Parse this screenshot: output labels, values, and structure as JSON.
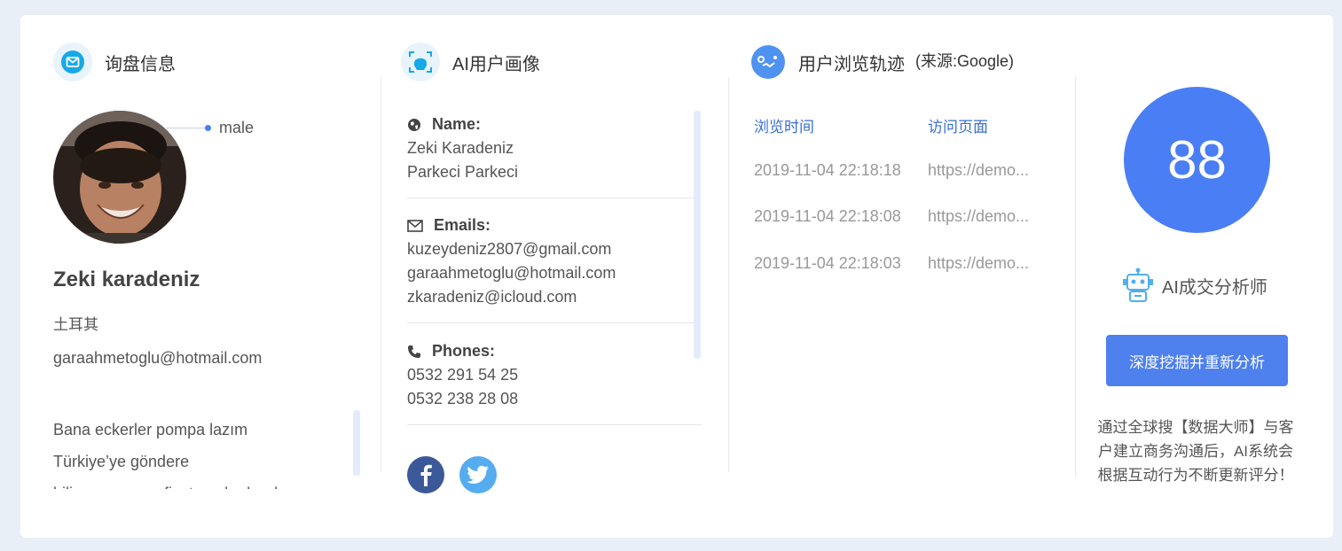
{
  "inquiry": {
    "title": "询盘信息",
    "gender": "male",
    "name": "Zeki karadeniz",
    "country": "土耳其",
    "email": "garaahmetoglu@hotmail.com",
    "message_lines": [
      "Bana eckerler pompa lazım",
      "Türkiye’ye göndere",
      "biliyormusunuz fiyatı ne kadar dır"
    ]
  },
  "portrait": {
    "title": "AI用户画像",
    "name_label": "Name:",
    "names": [
      "Zeki Karadeniz",
      "Parkeci Parkeci"
    ],
    "emails_label": "Emails:",
    "emails": [
      "kuzeydeniz2807@gmail.com",
      "garaahmetoglu@hotmail.com",
      "zkaradeniz@icloud.com"
    ],
    "phones_label": "Phones:",
    "phones": [
      "0532 291 54 25",
      "0532 238 28 08"
    ]
  },
  "browsing": {
    "title": "用户浏览轨迹",
    "source": "(来源:Google)",
    "col_time": "浏览时间",
    "col_page": "访问页面",
    "rows": [
      {
        "time": "2019-11-04 22:18:18",
        "page": "https://demo..."
      },
      {
        "time": "2019-11-04 22:18:08",
        "page": "https://demo..."
      },
      {
        "time": "2019-11-04 22:18:03",
        "page": "https://demo..."
      }
    ]
  },
  "score": {
    "value": "88",
    "analyst": "AI成交分析师",
    "button": "深度挖掘并重新分析",
    "note": "通过全球搜【数据大师】与客户建立商务沟通后，AI系统会根据互动行为不断更新评分！"
  },
  "colors": {
    "accent": "#4a7ef5",
    "button": "#4e80ee",
    "link": "#3a6fd0",
    "facebook": "#3b5998",
    "twitter": "#55acee"
  }
}
